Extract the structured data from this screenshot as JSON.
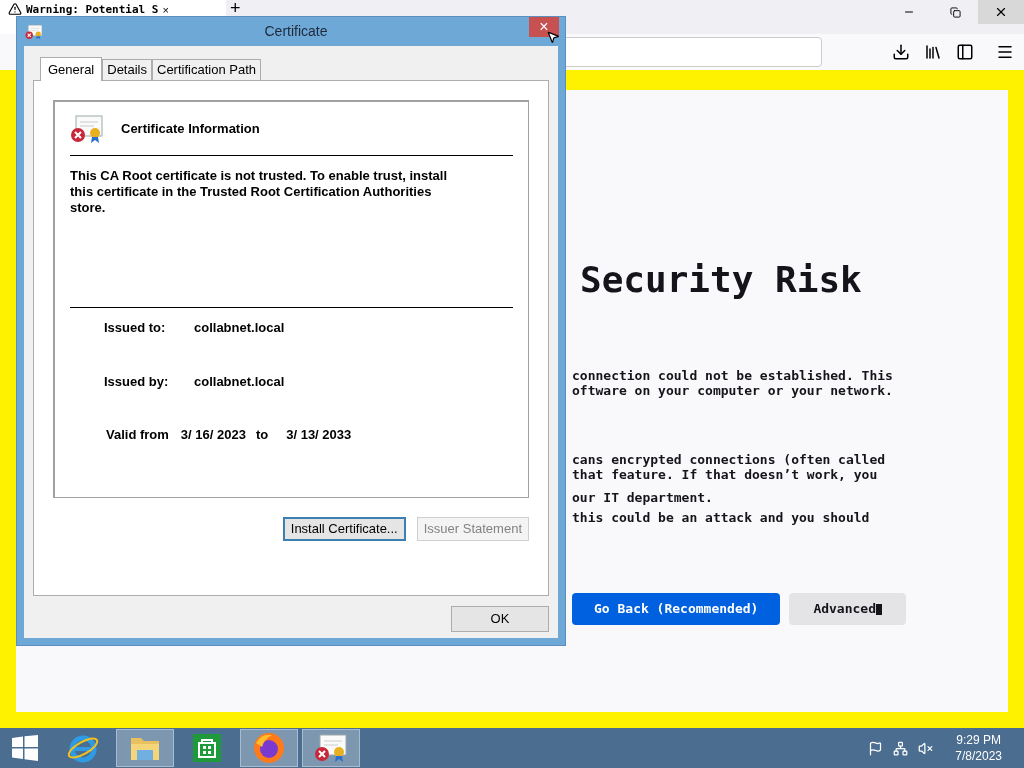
{
  "browser": {
    "tab": {
      "title": "Warning: Potential S",
      "close": "×"
    },
    "new_tab": "+",
    "page": {
      "heading": "Security Risk",
      "paragraphs": [
        [
          "connection could not be established. This",
          "oftware on your computer or your network."
        ],
        [
          "cans encrypted connections (often called",
          "that feature. If that doesn’t work, you"
        ],
        [
          "our IT department."
        ],
        [
          "this could be an attack and you should"
        ]
      ],
      "buttons": [
        {
          "label": "Go Back (Recommended)",
          "kind": "primary"
        },
        {
          "label": "Advanced",
          "kind": "secondary",
          "caret": true
        }
      ]
    }
  },
  "dialog": {
    "title": "Certificate",
    "close": "×",
    "tabs": [
      {
        "label": "General",
        "selected": true
      },
      {
        "label": "Details",
        "selected": false
      },
      {
        "label": "Certification Path",
        "selected": false
      }
    ],
    "heading": "Certificate Information",
    "message": "This CA Root certificate is not trusted. To enable trust, install this certificate in the Trusted Root Certification Authorities store.",
    "issued_to": {
      "label": "Issued to:",
      "value": "collabnet.local"
    },
    "issued_by": {
      "label": "Issued by:",
      "value": "collabnet.local"
    },
    "validity": {
      "label": "Valid from",
      "from": "3/ 16/ 2023",
      "to_label": "to",
      "to": "3/ 13/ 2033"
    },
    "buttons": [
      {
        "label": "Install Certificate...",
        "disabled": false,
        "focused": true
      },
      {
        "label": "Issuer Statement",
        "disabled": true,
        "focused": false
      }
    ],
    "ok": "OK"
  },
  "taskbar": {
    "apps": [
      {
        "kind": "ie",
        "open": false
      },
      {
        "kind": "explorer",
        "open": true
      },
      {
        "kind": "store",
        "open": false
      },
      {
        "kind": "firefox",
        "open": true
      },
      {
        "kind": "certificate",
        "open": true
      }
    ],
    "time": "9:29 PM",
    "date": "7/8/2023"
  }
}
